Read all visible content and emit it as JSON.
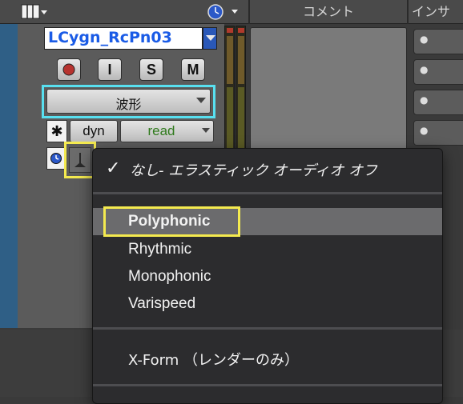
{
  "header": {
    "comment_label": "コメント",
    "insert_label": "インサ"
  },
  "track": {
    "name": "LCygn_RcPn03",
    "rec_label": "●",
    "input_label": "I",
    "solo_label": "S",
    "mute_label": "M",
    "view_label": "波形",
    "dyn_label": "dyn",
    "automation_mode": "read",
    "asterisk": "✱"
  },
  "menu": {
    "checked_item": "なし- エラスティック オーディオ オフ",
    "checkmark": "✓",
    "items": [
      "Polyphonic",
      "Rhythmic",
      "Monophonic",
      "Varispeed"
    ],
    "highlighted": "Polyphonic",
    "xform": "X-Form （レンダーのみ）"
  },
  "colors": {
    "track_blue": "#2f5f86",
    "name_text": "#1a5be6",
    "highlight_cyan": "#58e0f0",
    "highlight_yellow": "#f4ea4f",
    "automation_green": "#2f7a1c"
  }
}
